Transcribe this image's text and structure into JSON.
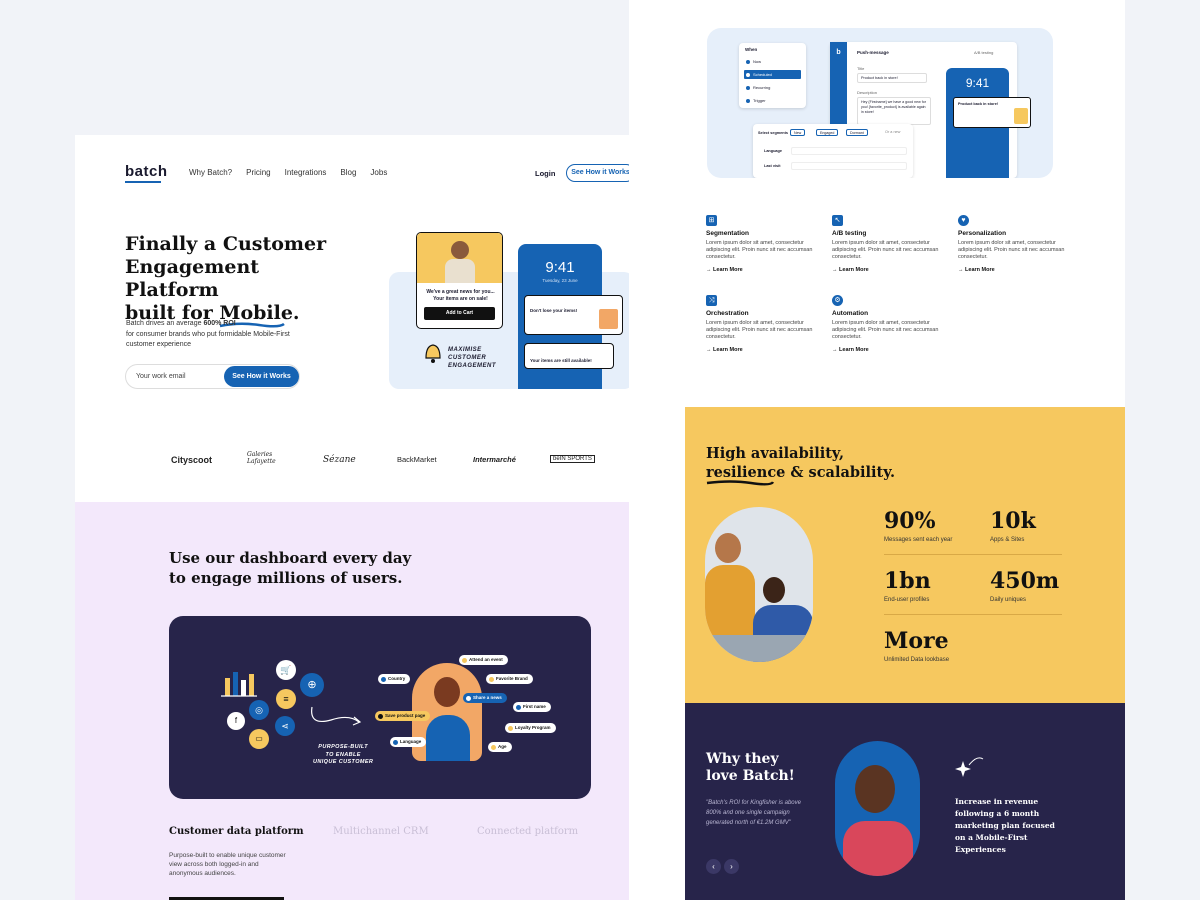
{
  "left": {
    "nav": {
      "logo": "batch",
      "links": [
        "Why Batch?",
        "Pricing",
        "Integrations",
        "Blog",
        "Jobs"
      ],
      "login": "Login",
      "cta": "See How it Works"
    },
    "hero": {
      "title_line1": "Finally a Customer",
      "title_line2": "Engagement Platform",
      "title_line3_prefix": "built for ",
      "title_line3_highlight": "Mobile",
      "title_line3_suffix": ".",
      "sub_prefix": "Batch drives an average ",
      "sub_bold": "600% ROI",
      "sub_rest": "for consumer brands who put formidable Mobile-First customer experience",
      "email_placeholder": "Your work email",
      "email_button": "See How it Works",
      "phone_time": "9:41",
      "phone_date": "Tuesday, 23 June",
      "card_text": "We've a great news for you... Your items are on sale!",
      "card_button": "Add to Cart",
      "notif1": "Don't lose your items!",
      "notif2": "Your items are still available!",
      "handwritten": [
        "MAXIMISE",
        "CUSTOMER",
        "ENGAGEMENT"
      ]
    },
    "clients": [
      "Cityscoot",
      "Galeries Lafayette",
      "Sézane",
      "BackMarket",
      "Intermarché",
      "beIN SPORTS"
    ],
    "dashboard": {
      "title_line1": "Use our dashboard every day",
      "title_line2": "to engage millions of users.",
      "chips": [
        "Attend an event",
        "Country",
        "Favorite Brand",
        "Share a news",
        "First name",
        "Save product page",
        "Loyalty Program",
        "Language",
        "Age"
      ],
      "handwritten": [
        "PURPOSE-BUILT",
        "TO ENABLE",
        "UNIQUE CUSTOMER"
      ],
      "tabs": [
        "Customer data platform",
        "Multichannel CRM",
        "Connected platform"
      ],
      "tab_desc": "Purpose-built to enable unique customer view across both logged-in and anonymous audiences."
    }
  },
  "right": {
    "editor": {
      "when_label": "When",
      "when_options": [
        "Now",
        "Scheduled",
        "Recurring",
        "Trigger"
      ],
      "panel_title": "Push-message",
      "ab_label": "A/B testing",
      "title_label": "Title",
      "title_value": "Product back in store!",
      "desc_label": "Description",
      "desc_value": "Hey {Firstname} we have a good new for you! {favorite_product} is available again in store!",
      "phone_time": "9:41",
      "notif": "Product back in store!",
      "segments_label": "Select segments",
      "segments": [
        "New",
        "Engaged",
        "Dormant",
        "Or a new"
      ],
      "rows": [
        "Language",
        "Last visit"
      ],
      "row_values": [
        "is one of",
        "French",
        "English",
        "German",
        "After",
        "From date",
        "To",
        "Past"
      ]
    },
    "features": [
      {
        "icon": "segmentation-icon",
        "title": "Segmentation",
        "desc": "Lorem ipsum dolor sit amet, consectetur adipiscing elit. Proin nunc sit nec accumsan consectetur.",
        "link": "Learn More"
      },
      {
        "icon": "ab-testing-icon",
        "title": "A/B testing",
        "desc": "Lorem ipsum dolor sit amet, consectetur adipiscing elit. Proin nunc sit nec accumsan consectetur.",
        "link": "Learn More"
      },
      {
        "icon": "personalization-icon",
        "title": "Personalization",
        "desc": "Lorem ipsum dolor sit amet, consectetur adipiscing elit. Proin nunc sit nec accumsan consectetur.",
        "link": "Learn More"
      },
      {
        "icon": "orchestration-icon",
        "title": "Orchestration",
        "desc": "Lorem ipsum dolor sit amet, consectetur adipiscing elit. Proin nunc sit nec accumsan consectetur.",
        "link": "Learn More"
      },
      {
        "icon": "automation-icon",
        "title": "Automation",
        "desc": "Lorem ipsum dolor sit amet, consectetur adipiscing elit. Proin nunc sit nec accumsan consectetur.",
        "link": "Learn More"
      }
    ],
    "stats": {
      "title_line1": "High availability,",
      "title_line2_underlined": "resilience",
      "title_line2_rest": " & scalability.",
      "items": [
        {
          "value": "90%",
          "label": "Messages sent each year"
        },
        {
          "value": "10k",
          "label": "Apps & Sites"
        },
        {
          "value": "1bn",
          "label": "End-user profiles"
        },
        {
          "value": "450m",
          "label": "Daily uniques"
        },
        {
          "value": "More",
          "label": "Unlimited Data lookbase"
        }
      ]
    },
    "testimonial": {
      "title_line1": "Why they",
      "title_line2": "love Batch!",
      "quote": "\"Batch's ROI for Kingfisher is above 800% and one single campaign generated north of €1.2M GMV\"",
      "highlight": "Increase in revenue following a 6 month marketing plan focused on a Mobile-First Experiences"
    }
  },
  "colors": {
    "brand_blue": "#1663b3",
    "navy": "#27244a",
    "yellow": "#f6c85f",
    "lavender": "#f3e8fb"
  }
}
